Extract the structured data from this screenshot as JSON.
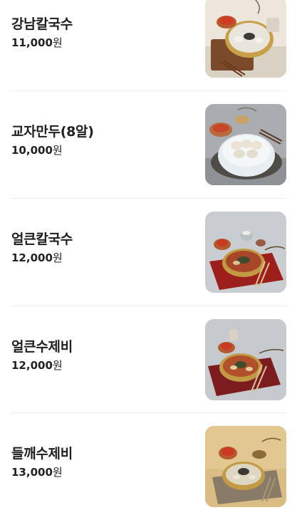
{
  "menu": {
    "items": [
      {
        "name": "강남칼국수",
        "price": "11,000",
        "unit": "원",
        "image": "kalguksu-photo"
      },
      {
        "name": "교자만두(8알)",
        "price": "10,000",
        "unit": "원",
        "image": "dumplings-photo"
      },
      {
        "name": "얼큰칼국수",
        "price": "12,000",
        "unit": "원",
        "image": "spicy-kalguksu-photo"
      },
      {
        "name": "얼큰수제비",
        "price": "12,000",
        "unit": "원",
        "image": "spicy-sujebi-photo"
      },
      {
        "name": "들깨수제비",
        "price": "13,000",
        "unit": "원",
        "image": "perilla-sujebi-photo"
      }
    ]
  }
}
